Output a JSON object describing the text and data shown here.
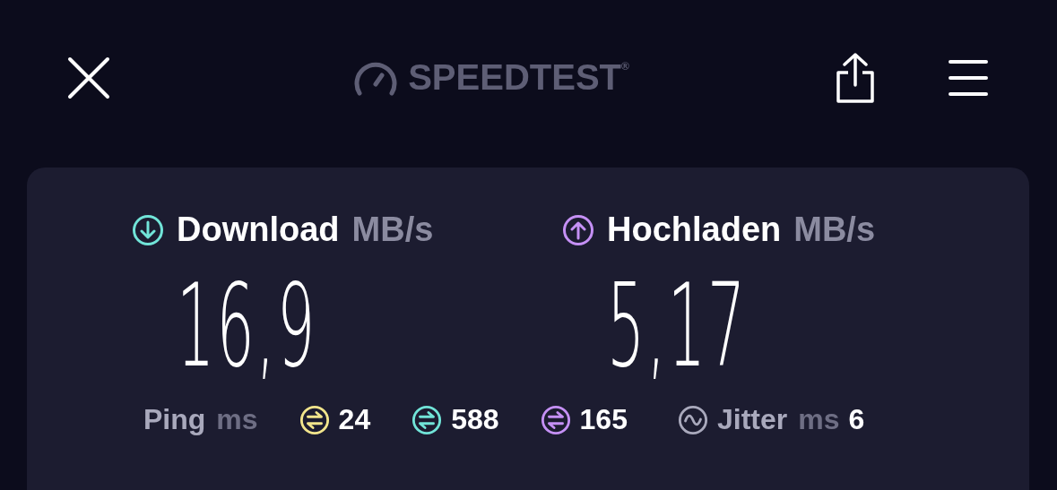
{
  "header": {
    "logo": "SPEEDTEST$^{®}$"
  },
  "metrics": [
    {
      "kind": "download",
      "label": "Download",
      "unit": "MB/s",
      "value": "16,9",
      "color": "#71e4d8"
    },
    {
      "kind": "upload",
      "label": "Hochladen",
      "unit": "MB/s",
      "value": "5,17",
      "color": "#c590f5"
    }
  ],
  "ping": {
    "label": "Ping",
    "unit": "ms",
    "items": [
      {
        "value": "24",
        "color": "#f2e58c"
      },
      {
        "value": "588",
        "color": "#71e4d8"
      },
      {
        "value": "165",
        "color": "#c590f5"
      }
    ]
  },
  "jitter": {
    "label": "Jitter",
    "unit": "ms",
    "value": "6"
  }
}
